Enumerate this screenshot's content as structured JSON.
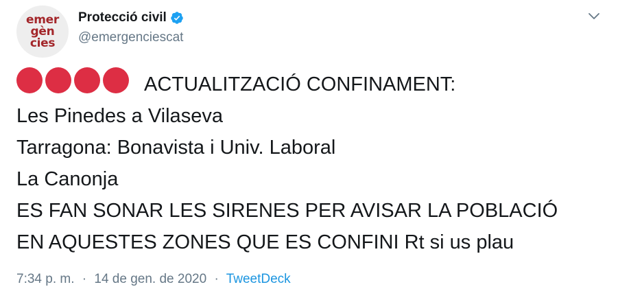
{
  "author": {
    "avatar_text": [
      "emer",
      "gèn",
      "cies"
    ],
    "display_name": "Protecció civil",
    "handle": "@emergenciescat",
    "verified": true
  },
  "colors": {
    "accent": "#1b95e0",
    "alert_circle": "#dd2e44",
    "avatar_red": "#a3262a",
    "muted": "#657786"
  },
  "tweet": {
    "emoji": "red-circle",
    "emoji_count": 4,
    "lines": [
      "ACTUALITZACIÓ CONFINAMENT:",
      "Les Pinedes a Vilaseva",
      "Tarragona: Bonavista i Univ. Laboral",
      "La Canonja",
      "ES FAN SONAR LES SIRENES PER AVISAR LA POBLACIÓ",
      "EN AQUESTES ZONES QUE ES CONFINI Rt si us plau"
    ]
  },
  "meta": {
    "time": "7:34 p. m.",
    "separator": "·",
    "date": "14 de gen. de 2020",
    "source": "TweetDeck"
  }
}
